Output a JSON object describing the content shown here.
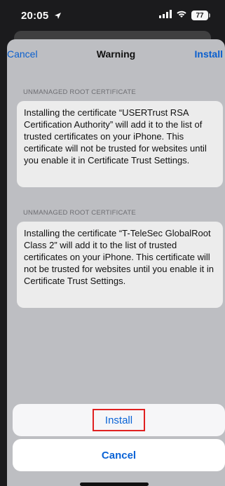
{
  "status": {
    "time": "20:05",
    "battery": "77"
  },
  "nav": {
    "cancel": "Cancel",
    "title": "Warning",
    "install": "Install"
  },
  "sections": [
    {
      "header": "UNMANAGED ROOT CERTIFICATE",
      "text": "Installing the certificate “USERTrust RSA Certification Authority” will add it to the list of trusted certificates on your iPhone. This certificate will not be trusted for websites until you enable it in Certificate Trust Settings."
    },
    {
      "header": "UNMANAGED ROOT CERTIFICATE",
      "text": "Installing the certificate “T-TeleSec GlobalRoot Class 2” will add it to the list of trusted certificates on your iPhone. This certificate will not be trusted for websites until you enable it in Certificate Trust Settings."
    }
  ],
  "action_sheet": {
    "install": "Install",
    "cancel": "Cancel"
  },
  "colors": {
    "accent": "#0a63d6",
    "highlight": "#e02020"
  },
  "icons": [
    "location-arrow-icon",
    "cellular-signal-icon",
    "wifi-icon",
    "battery-icon"
  ]
}
